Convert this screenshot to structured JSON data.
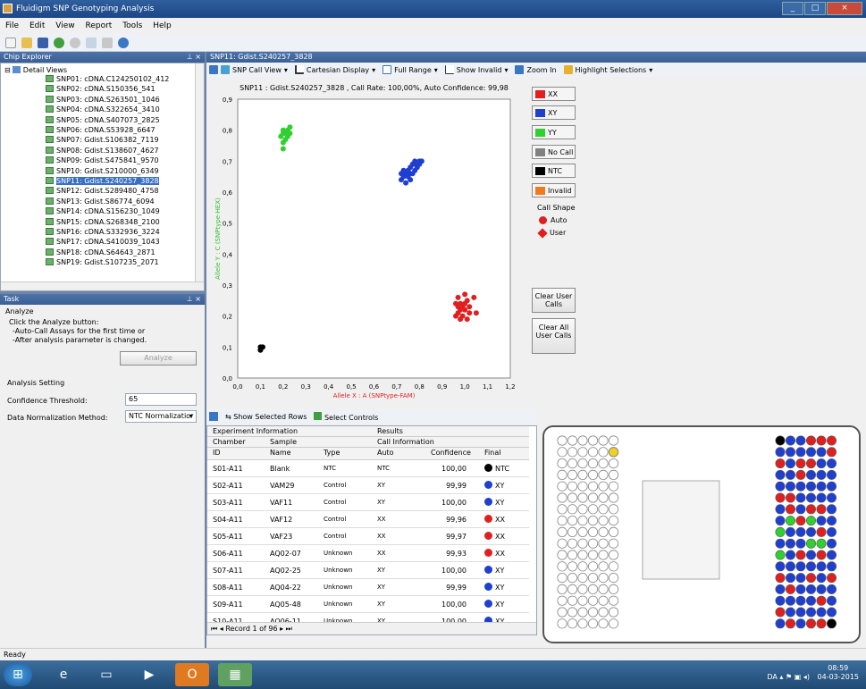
{
  "window": {
    "title": "Fluidigm SNP Genotyping Analysis"
  },
  "menu": [
    "File",
    "Edit",
    "View",
    "Report",
    "Tools",
    "Help"
  ],
  "chip_explorer": {
    "title": "Chip Explorer",
    "root": "Detail Views",
    "items": [
      "SNP01: cDNA.C124250102_412",
      "SNP02: cDNA.S150356_541",
      "SNP03: cDNA.S263501_1046",
      "SNP04: cDNA.S322654_3410",
      "SNP05: cDNA.S407073_2825",
      "SNP06: cDNA.S53928_6647",
      "SNP07: Gdist.S106382_7119",
      "SNP08: Gdist.S138607_4627",
      "SNP09: Gdist.S475841_9570",
      "SNP10: Gdist.S210000_6349",
      "SNP11: Gdist.S240257_3828",
      "SNP12: Gdist.S289480_4758",
      "SNP13: Gdist.S86774_6094",
      "SNP14: cDNA.S156230_1049",
      "SNP15: cDNA.S268348_2100",
      "SNP16: cDNA.S332936_3224",
      "SNP17: cDNA.S410039_1043",
      "SNP18: cDNA.S64643_2871",
      "SNP19: Gdist.S107235_2071"
    ],
    "selected_index": 10
  },
  "task": {
    "title": "Task",
    "heading": "Analyze",
    "line1": "Click the Analyze button:",
    "line2": "-Auto-Call Assays for the first time or",
    "line3": "-After analysis parameter is changed.",
    "analyze_button": "Analyze",
    "settings_heading": "Analysis Setting",
    "confidence_label": "Confidence Threshold:",
    "confidence_value": "65",
    "normalization_label": "Data Normalization Method:",
    "normalization_value": "NTC Normalizatior"
  },
  "doc_tab": {
    "title": "SNP11: Gdist.S240257_3828"
  },
  "plot_toolbar": {
    "snp_call_view": "SNP Call View",
    "cartesian": "Cartesian Display",
    "full_range": "Full Range",
    "show_invalid": "Show Invalid",
    "zoom_in": "Zoom In",
    "highlight": "Highlight Selections"
  },
  "legend": {
    "xx": "XX",
    "xy": "XY",
    "yy": "YY",
    "no_call": "No Call",
    "ntc": "NTC",
    "invalid": "Invalid",
    "call_shape": "Call Shape",
    "auto": "Auto",
    "user": "User",
    "clear_user_calls": "Clear User Calls",
    "clear_all_user_calls": "Clear All User Calls",
    "colors": {
      "xx": "#e02020",
      "xy": "#1f3fd0",
      "yy": "#30d030",
      "no_call": "#808080",
      "ntc": "#000000",
      "invalid": "#f07a20"
    }
  },
  "chart_data": {
    "type": "scatter",
    "title": "SNP11 : Gdist.S240257_3828 , Call Rate: 100,00%, Auto Confidence: 99,98",
    "xlabel": "Allele X : A (SNPtype-FAM)",
    "ylabel": "Allele Y : C (SNPtype-HEX)",
    "xlim": [
      0,
      1.2
    ],
    "ylim": [
      0,
      0.9
    ],
    "xticks": [
      "0,0",
      "0,1",
      "0,2",
      "0,3",
      "0,4",
      "0,5",
      "0,6",
      "0,7",
      "0,8",
      "0,9",
      "1,0",
      "1,1",
      "1,2"
    ],
    "yticks": [
      "0,0",
      "0,1",
      "0,2",
      "0,3",
      "0,4",
      "0,5",
      "0,6",
      "0,7",
      "0,8",
      "0,9"
    ],
    "series": [
      {
        "name": "YY",
        "color": "#30d030",
        "points": [
          [
            0.2,
            0.74
          ],
          [
            0.2,
            0.76
          ],
          [
            0.19,
            0.78
          ],
          [
            0.21,
            0.79
          ],
          [
            0.2,
            0.79
          ],
          [
            0.22,
            0.78
          ],
          [
            0.22,
            0.8
          ],
          [
            0.23,
            0.81
          ],
          [
            0.21,
            0.77
          ],
          [
            0.2,
            0.8
          ],
          [
            0.23,
            0.79
          ]
        ]
      },
      {
        "name": "XY",
        "color": "#1f3fd0",
        "points": [
          [
            0.72,
            0.64
          ],
          [
            0.73,
            0.65
          ],
          [
            0.74,
            0.66
          ],
          [
            0.75,
            0.67
          ],
          [
            0.76,
            0.68
          ],
          [
            0.77,
            0.69
          ],
          [
            0.78,
            0.7
          ],
          [
            0.8,
            0.7
          ],
          [
            0.75,
            0.65
          ],
          [
            0.77,
            0.66
          ],
          [
            0.79,
            0.68
          ],
          [
            0.78,
            0.69
          ],
          [
            0.74,
            0.63
          ],
          [
            0.76,
            0.64
          ],
          [
            0.8,
            0.69
          ],
          [
            0.81,
            0.7
          ],
          [
            0.73,
            0.67
          ],
          [
            0.78,
            0.67
          ],
          [
            0.72,
            0.66
          ],
          [
            0.76,
            0.66
          ]
        ]
      },
      {
        "name": "XX",
        "color": "#e02020",
        "points": [
          [
            0.96,
            0.2
          ],
          [
            0.97,
            0.21
          ],
          [
            0.98,
            0.22
          ],
          [
            0.99,
            0.23
          ],
          [
            1.0,
            0.24
          ],
          [
            1.01,
            0.25
          ],
          [
            0.97,
            0.23
          ],
          [
            0.98,
            0.24
          ],
          [
            1.0,
            0.22
          ],
          [
            1.02,
            0.21
          ],
          [
            0.99,
            0.2
          ],
          [
            1.01,
            0.19
          ],
          [
            0.96,
            0.24
          ],
          [
            1.04,
            0.26
          ],
          [
            1.0,
            0.27
          ],
          [
            0.97,
            0.26
          ],
          [
            1.05,
            0.21
          ],
          [
            0.98,
            0.19
          ],
          [
            1.02,
            0.23
          ]
        ]
      },
      {
        "name": "NTC",
        "color": "#000000",
        "points": [
          [
            0.1,
            0.1
          ],
          [
            0.11,
            0.1
          ],
          [
            0.1,
            0.09
          ]
        ]
      }
    ]
  },
  "grid_toolbar": {
    "show_selected": "Show Selected Rows",
    "select_controls": "Select Controls"
  },
  "table": {
    "group1": "Experiment Information",
    "group2": "Results",
    "sub1": "Chamber",
    "sub2": "Sample",
    "sub3": "Call Information",
    "columns": [
      "ID",
      "Name",
      "Type",
      "Auto",
      "Confidence",
      "Final"
    ],
    "rows": [
      {
        "id": "S01-A11",
        "name": "Blank",
        "type": "NTC",
        "auto": "NTC",
        "conf": "100,00",
        "final": "NTC",
        "color": "#000000"
      },
      {
        "id": "S02-A11",
        "name": "VAM29",
        "type": "Control",
        "auto": "XY",
        "conf": "99,99",
        "final": "XY",
        "color": "#1f3fd0"
      },
      {
        "id": "S03-A11",
        "name": "VAF11",
        "type": "Control",
        "auto": "XY",
        "conf": "100,00",
        "final": "XY",
        "color": "#1f3fd0"
      },
      {
        "id": "S04-A11",
        "name": "VAF12",
        "type": "Control",
        "auto": "XX",
        "conf": "99,96",
        "final": "XX",
        "color": "#e02020"
      },
      {
        "id": "S05-A11",
        "name": "VAF23",
        "type": "Control",
        "auto": "XX",
        "conf": "99,97",
        "final": "XX",
        "color": "#e02020"
      },
      {
        "id": "S06-A11",
        "name": "AQ02-07",
        "type": "Unknown",
        "auto": "XX",
        "conf": "99,93",
        "final": "XX",
        "color": "#e02020"
      },
      {
        "id": "S07-A11",
        "name": "AQ02-25",
        "type": "Unknown",
        "auto": "XY",
        "conf": "100,00",
        "final": "XY",
        "color": "#1f3fd0"
      },
      {
        "id": "S08-A11",
        "name": "AQ04-22",
        "type": "Unknown",
        "auto": "XY",
        "conf": "99,99",
        "final": "XY",
        "color": "#1f3fd0"
      },
      {
        "id": "S09-A11",
        "name": "AQ05-48",
        "type": "Unknown",
        "auto": "XY",
        "conf": "100,00",
        "final": "XY",
        "color": "#1f3fd0"
      },
      {
        "id": "S10-A11",
        "name": "AQ06-11",
        "type": "Unknown",
        "auto": "XY",
        "conf": "100,00",
        "final": "XY",
        "color": "#1f3fd0"
      }
    ],
    "record": "Record 1 of 96"
  },
  "plate": {
    "right_rows": [
      [
        "#000",
        "#1f3fd0",
        "#1f3fd0",
        "#e02020",
        "#e02020",
        "#e02020"
      ],
      [
        "#1f3fd0",
        "#1f3fd0",
        "#1f3fd0",
        "#1f3fd0",
        "#1f3fd0",
        "#e02020"
      ],
      [
        "#e02020",
        "#1f3fd0",
        "#e02020",
        "#e02020",
        "#1f3fd0",
        "#1f3fd0"
      ],
      [
        "#1f3fd0",
        "#1f3fd0",
        "#e02020",
        "#1f3fd0",
        "#1f3fd0",
        "#1f3fd0"
      ],
      [
        "#1f3fd0",
        "#1f3fd0",
        "#1f3fd0",
        "#1f3fd0",
        "#1f3fd0",
        "#1f3fd0"
      ],
      [
        "#e02020",
        "#e02020",
        "#1f3fd0",
        "#1f3fd0",
        "#1f3fd0",
        "#1f3fd0"
      ],
      [
        "#1f3fd0",
        "#e02020",
        "#1f3fd0",
        "#e02020",
        "#e02020",
        "#1f3fd0"
      ],
      [
        "#1f3fd0",
        "#30d030",
        "#e02020",
        "#30d030",
        "#1f3fd0",
        "#1f3fd0"
      ],
      [
        "#30d030",
        "#1f3fd0",
        "#1f3fd0",
        "#1f3fd0",
        "#e02020",
        "#1f3fd0"
      ],
      [
        "#1f3fd0",
        "#1f3fd0",
        "#1f3fd0",
        "#30d030",
        "#30d030",
        "#1f3fd0"
      ],
      [
        "#30d030",
        "#1f3fd0",
        "#e02020",
        "#1f3fd0",
        "#e02020",
        "#1f3fd0"
      ],
      [
        "#1f3fd0",
        "#1f3fd0",
        "#1f3fd0",
        "#1f3fd0",
        "#1f3fd0",
        "#1f3fd0"
      ],
      [
        "#e02020",
        "#1f3fd0",
        "#1f3fd0",
        "#e02020",
        "#1f3fd0",
        "#e02020"
      ],
      [
        "#1f3fd0",
        "#e02020",
        "#1f3fd0",
        "#1f3fd0",
        "#1f3fd0",
        "#1f3fd0"
      ],
      [
        "#1f3fd0",
        "#1f3fd0",
        "#1f3fd0",
        "#1f3fd0",
        "#e02020",
        "#1f3fd0"
      ],
      [
        "#e02020",
        "#1f3fd0",
        "#1f3fd0",
        "#1f3fd0",
        "#1f3fd0",
        "#1f3fd0"
      ],
      [
        "#1f3fd0",
        "#e02020",
        "#1f3fd0",
        "#e02020",
        "#e02020",
        "#000"
      ]
    ]
  },
  "status": "Ready",
  "tray": {
    "lang": "DA",
    "time": "08:59",
    "date": "04-03-2015"
  }
}
